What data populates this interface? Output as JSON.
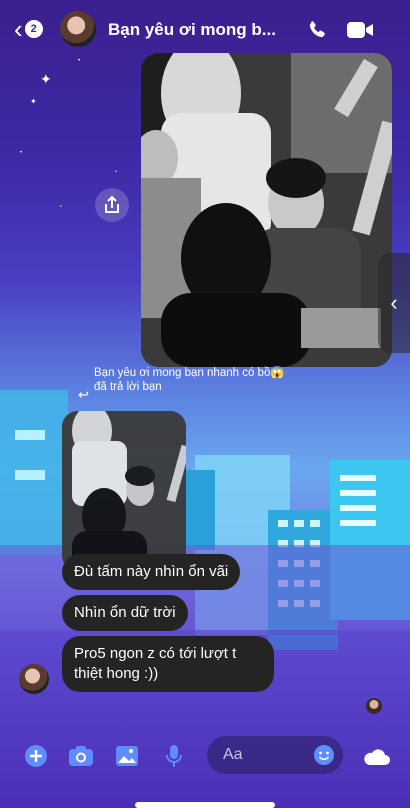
{
  "header": {
    "back_badge": "2",
    "title": "Bạn yêu ơi mong b...",
    "call_icon": "phone-icon",
    "video_icon": "video-camera-icon"
  },
  "reply_notice": "Bạn yêu ơi mong bạn nhanh có bồ😱 đã trả lời bạn",
  "messages": [
    "Đù tấm này nhìn ổn vãi",
    "Nhìn ổn dữ trời",
    "Pro5 ngon z có tới lượt t thiệt hong :))"
  ],
  "composer": {
    "placeholder": "Aa",
    "icons": [
      "plus-icon",
      "camera-icon",
      "image-icon",
      "microphone-icon",
      "emoji-icon",
      "cloud-icon"
    ]
  },
  "colors": {
    "accent": "#5b7fe0",
    "bubble": "#242424",
    "icon_blue": "#5f8cff"
  }
}
